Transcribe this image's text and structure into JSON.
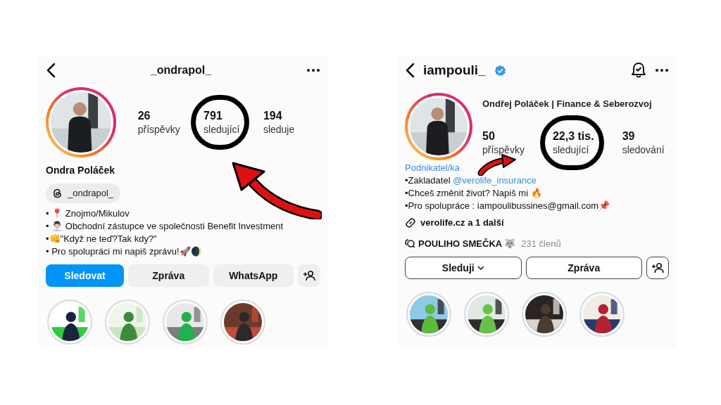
{
  "profiles": [
    {
      "username": "_ondrapol_",
      "verified": false,
      "display_name": "Ondra Poláček",
      "stats": [
        {
          "value": "26",
          "label": "příspěvky",
          "circled": false
        },
        {
          "value": "791",
          "label": "sledující",
          "circled": true
        },
        {
          "value": "194",
          "label": "sleduje",
          "circled": false
        }
      ],
      "threads_handle": "_ondrapol_",
      "bio": [
        {
          "text": "• 📍 Znojmo/Mikulov"
        },
        {
          "text": "• 👨🏻‍💼 Obchodní zástupce ve společnosti Benefit Investment"
        },
        {
          "text": "•👊\"Když ne teď?Tak kdy?\""
        },
        {
          "text": "• Pro spolupráci mi napiš zprávu!🚀🌒"
        }
      ],
      "buttons": [
        {
          "kind": "primary",
          "label": "Sledovat"
        },
        {
          "kind": "secondary",
          "label": "Zpráva"
        },
        {
          "kind": "secondary",
          "label": "WhatsApp"
        },
        {
          "kind": "add-person"
        }
      ],
      "highlights": [
        {
          "kind": "picture"
        },
        {
          "kind": "picture"
        },
        {
          "kind": "picture"
        },
        {
          "kind": "picture"
        }
      ]
    },
    {
      "username": "iampouli_",
      "verified": true,
      "display_name": "Ondřej Poláček | Finance & Seberozvoj",
      "stats": [
        {
          "value": "50",
          "label": "příspěvky",
          "circled": false
        },
        {
          "value": "22,3 tis.",
          "label": "sledující",
          "circled": true
        },
        {
          "value": "39",
          "label": "sledování",
          "circled": false
        }
      ],
      "category": "Podnikatel/ka",
      "bio": [
        {
          "text": "•Zakladatel ",
          "mention": "@verolife_insurance"
        },
        {
          "text": "•Chceš změnit život? Napiš mi 🔥"
        },
        {
          "text": "•Pro spolupráce : iampoulibussines@gmail.com📌"
        }
      ],
      "link": "verolife.cz a 1 další",
      "community": {
        "name": "POULIHO SMEČKA 🐺",
        "members": "231 členů"
      },
      "buttons": [
        {
          "kind": "outline",
          "label": "Sleduji",
          "dropdown": true
        },
        {
          "kind": "outline",
          "label": "Zpráva"
        },
        {
          "kind": "add-person-outline"
        }
      ],
      "highlights": [
        {
          "kind": "picture"
        },
        {
          "kind": "picture"
        },
        {
          "kind": "picture"
        },
        {
          "kind": "picture"
        }
      ]
    }
  ]
}
